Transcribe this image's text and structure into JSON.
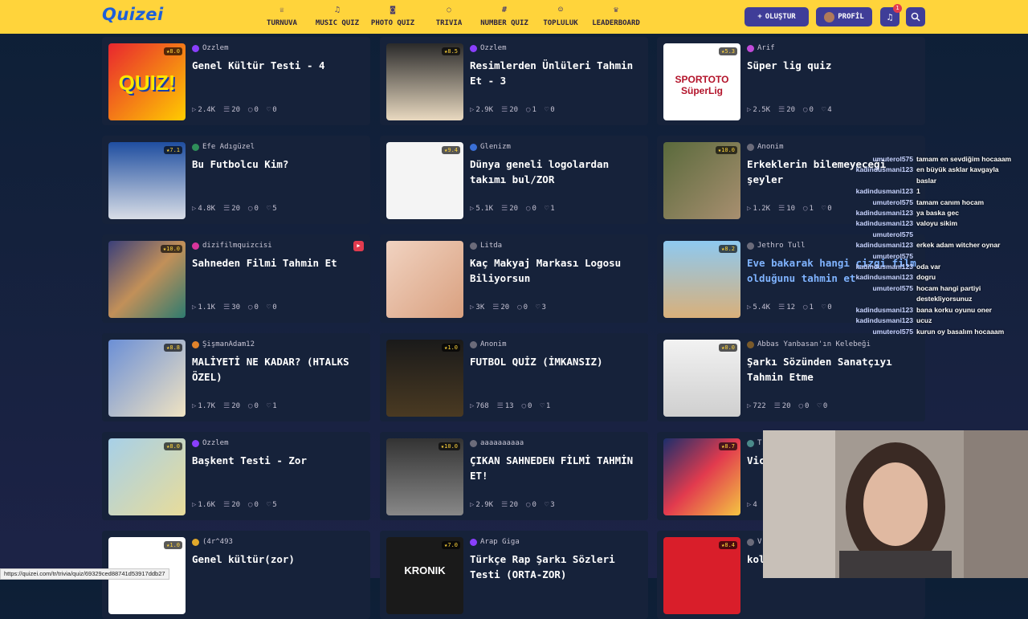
{
  "brand": {
    "logo": "Quizei",
    "accent": "#ffd43b",
    "nav_accent": "#3f3d98"
  },
  "nav": [
    {
      "label": "TURNUVA",
      "icon": "trophy-icon",
      "glyph": "♕"
    },
    {
      "label": "MUSIC QUIZ",
      "icon": "music-icon",
      "glyph": "♫"
    },
    {
      "label": "PHOTO QUIZ",
      "icon": "camera-icon",
      "glyph": "◙"
    },
    {
      "label": "TRIVIA",
      "icon": "chat-icon",
      "glyph": "◌"
    },
    {
      "label": "NUMBER QUIZ",
      "icon": "hash-icon",
      "glyph": "#"
    },
    {
      "label": "TOPLULUK",
      "icon": "people-icon",
      "glyph": "☺"
    },
    {
      "label": "LEADERBOARD",
      "icon": "medal-icon",
      "glyph": "♛"
    }
  ],
  "header": {
    "create_label": "OLUŞTUR",
    "profile_label": "PROFİL",
    "notifications": "1"
  },
  "cards": [
    {
      "author": "Ozzlem",
      "title": "Genel Kültür Testi - 4",
      "rating": "8.0",
      "plays": "2.4K",
      "questions": "20",
      "comments": "0",
      "likes": "0",
      "thumb": "QUIZ!"
    },
    {
      "author": "Ozzlem",
      "title": "Resimlerden Ünlüleri Tahmin Et - 3",
      "rating": "8.5",
      "plays": "2.9K",
      "questions": "20",
      "comments": "1",
      "likes": "0",
      "thumb": ""
    },
    {
      "author": "Arif",
      "title": "Süper lig quiz",
      "rating": "5.3",
      "plays": "2.5K",
      "questions": "20",
      "comments": "0",
      "likes": "4",
      "thumb": "SPORTOTO SüperLig"
    },
    {
      "author": "Efe Adıgüzel",
      "title": "Bu Futbolcu Kim?",
      "rating": "7.1",
      "plays": "4.8K",
      "questions": "20",
      "comments": "0",
      "likes": "5",
      "thumb": ""
    },
    {
      "author": "Glenizm",
      "title": "Dünya geneli logolardan takımı bul/ZOR",
      "rating": "9.4",
      "plays": "5.1K",
      "questions": "20",
      "comments": "0",
      "likes": "1",
      "thumb": ""
    },
    {
      "author": "Anonim",
      "title": "Erkeklerin bilemeyeceği şeyler",
      "rating": "10.0",
      "plays": "1.2K",
      "questions": "10",
      "comments": "1",
      "likes": "0",
      "thumb": ""
    },
    {
      "author": "dizifilmquizcisi",
      "title": "Sahneden Filmi Tahmin Et",
      "rating": "10.0",
      "plays": "1.1K",
      "questions": "30",
      "comments": "0",
      "likes": "0",
      "thumb": ""
    },
    {
      "author": "Litda",
      "title": "Kaç Makyaj Markası Logosu Biliyorsun",
      "rating": "",
      "plays": "3K",
      "questions": "20",
      "comments": "0",
      "likes": "3",
      "thumb": ""
    },
    {
      "author": "Jethro Tull",
      "title": "Eve bakarak hangi çizgi film olduğunu tahmin et",
      "rating": "8.2",
      "plays": "5.4K",
      "questions": "12",
      "comments": "1",
      "likes": "0",
      "thumb": ""
    },
    {
      "author": "ŞişmanAdam12",
      "title": "MALİYETİ NE KADAR? (HTALKS ÖZEL)",
      "rating": "8.8",
      "plays": "1.7K",
      "questions": "20",
      "comments": "0",
      "likes": "1",
      "thumb": ""
    },
    {
      "author": "Anonim",
      "title": "FUTBOL QUİZ (İMKANSIZ)",
      "rating": "1.0",
      "plays": "768",
      "questions": "13",
      "comments": "0",
      "likes": "1",
      "thumb": ""
    },
    {
      "author": "Abbas Yanbasan'ın Kelebeği",
      "title": "Şarkı Sözünden Sanatçıyı Tahmin Etme",
      "rating": "0.0",
      "plays": "722",
      "questions": "20",
      "comments": "0",
      "likes": "0",
      "thumb": ""
    },
    {
      "author": "Ozzlem",
      "title": "Başkent Testi - Zor",
      "rating": "8.0",
      "plays": "1.6K",
      "questions": "20",
      "comments": "0",
      "likes": "5",
      "thumb": ""
    },
    {
      "author": "aaaaaaaaaa",
      "title": "ÇIKAN SAHNEDEN FİLMİ TAHMİN ET!",
      "rating": "10.0",
      "plays": "2.9K",
      "questions": "20",
      "comments": "0",
      "likes": "3",
      "thumb": ""
    },
    {
      "author": "T",
      "title": "Vic Tah",
      "rating": "8.7",
      "plays": "4",
      "questions": "",
      "comments": "",
      "likes": "",
      "thumb": ""
    },
    {
      "author": "(4r^493",
      "title": "Genel kültür(zor)",
      "rating": "1.0",
      "plays": "",
      "questions": "",
      "comments": "",
      "likes": "",
      "thumb": ""
    },
    {
      "author": "Arap Giga",
      "title": "Türkçe Rap Şarkı Sözleri Testi (ORTA-ZOR)",
      "rating": "7.0",
      "plays": "",
      "questions": "",
      "comments": "",
      "likes": "",
      "thumb": "KRONIK"
    },
    {
      "author": "V",
      "title": "kol",
      "rating": "8.4",
      "plays": "",
      "questions": "",
      "comments": "",
      "likes": "",
      "thumb": ""
    }
  ],
  "chat": [
    {
      "user": "umuterol575",
      "msg": "tamam en sevdiğim hocaaam"
    },
    {
      "user": "kadindusmani123",
      "msg": "en büyük asklar kavgayla"
    },
    {
      "user": "",
      "msg": "baslar"
    },
    {
      "user": "kadindusmani123",
      "msg": "1"
    },
    {
      "user": "umuterol575",
      "msg": "tamam canım hocam"
    },
    {
      "user": "kadindusmani123",
      "msg": "ya baska gec"
    },
    {
      "user": "kadindusmani123",
      "msg": "valoyu sikim"
    },
    {
      "user": "umuterol575",
      "msg": ""
    },
    {
      "user": "kadindusmani123",
      "msg": "erkek adam witcher oynar"
    },
    {
      "user": "umuterol575",
      "msg": ""
    },
    {
      "user": "kadindusmani123",
      "msg": "oda var"
    },
    {
      "user": "kadindusmani123",
      "msg": "dogru"
    },
    {
      "user": "umuterol575",
      "msg": "hocam hangi partiyi"
    },
    {
      "user": "",
      "msg": "destekliyorsunuz"
    },
    {
      "user": "kadindusmani123",
      "msg": "bana korku oyunu oner"
    },
    {
      "user": "kadindusmani123",
      "msg": "ucuz"
    },
    {
      "user": "umuterol575",
      "msg": "kurun oy basalım hocaaam"
    }
  ],
  "status_url": "https://quizei.com/tr/trivia/quiz/69329ced88741d53917ddb27"
}
